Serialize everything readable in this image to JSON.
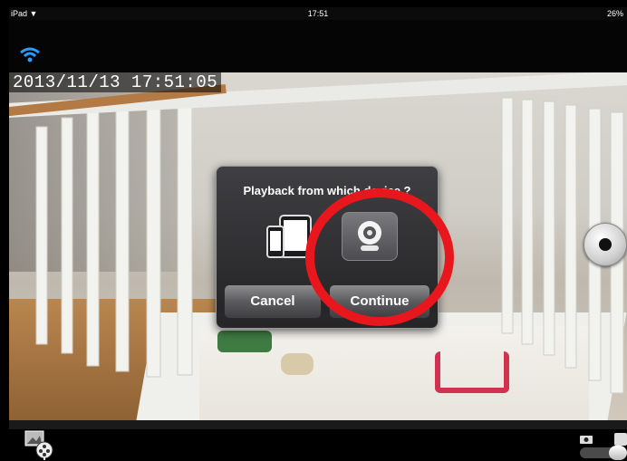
{
  "status_bar": {
    "device": "iPad",
    "time": "17:51",
    "battery": "26%"
  },
  "video": {
    "timestamp": "2013/11/13 17:51:05"
  },
  "dialog": {
    "title": "Playback from which device ?",
    "options": [
      {
        "icon": "phone-tablet-icon"
      },
      {
        "icon": "camera-icon"
      }
    ],
    "cancel_label": "Cancel",
    "continue_label": "Continue"
  },
  "colors": {
    "highlight": "#e8161d",
    "dialog_bg": "#2c2c30"
  },
  "toolbar": {
    "left_icon": "playback-reel-icon",
    "right_icons": [
      "snapshot-icon",
      "toggle-icon"
    ]
  }
}
